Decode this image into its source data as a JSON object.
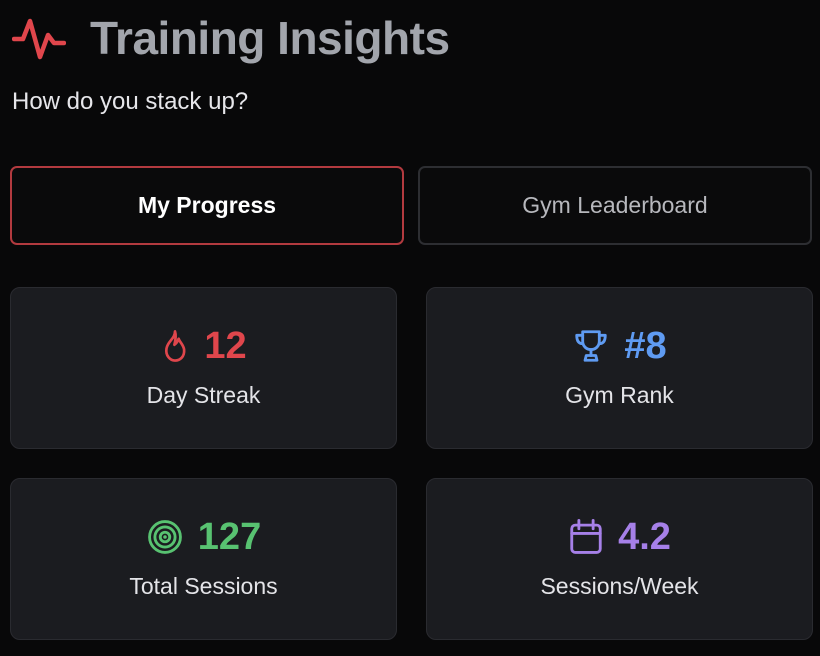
{
  "header": {
    "title": "Training Insights",
    "subtitle": "How do you stack up?",
    "icon": "activity-pulse-icon",
    "accent_color": "#e0464c"
  },
  "tabs": [
    {
      "label": "My Progress",
      "active": true
    },
    {
      "label": "Gym Leaderboard",
      "active": false
    }
  ],
  "stats": [
    {
      "value": "12",
      "label": "Day Streak",
      "icon": "flame-icon",
      "color": "#e0464c"
    },
    {
      "value": "#8",
      "label": "Gym Rank",
      "icon": "trophy-icon",
      "color": "#5f9bf2"
    },
    {
      "value": "127",
      "label": "Total Sessions",
      "icon": "target-icon",
      "color": "#58c271"
    },
    {
      "value": "4.2",
      "label": "Sessions/Week",
      "icon": "calendar-icon",
      "color": "#a680e8"
    }
  ]
}
